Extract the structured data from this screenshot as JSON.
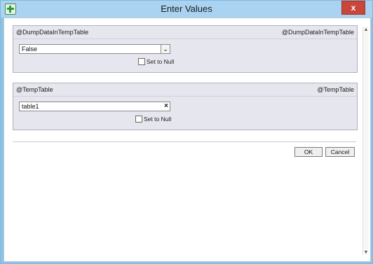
{
  "window": {
    "title": "Enter Values",
    "close_glyph": "x",
    "app_icon": "add-icon"
  },
  "param1": {
    "label_left": "@DumpDataInTempTable",
    "label_right": "@DumpDataInTempTable",
    "value": "False",
    "dropdown_glyph": "⌄",
    "set_null_label": "Set to Null"
  },
  "param2": {
    "label_left": "@TempTable",
    "label_right": "@TempTable",
    "value": "table1",
    "clear_glyph": "×",
    "set_null_label": "Set to Null"
  },
  "buttons": {
    "ok": "OK",
    "cancel": "Cancel"
  }
}
